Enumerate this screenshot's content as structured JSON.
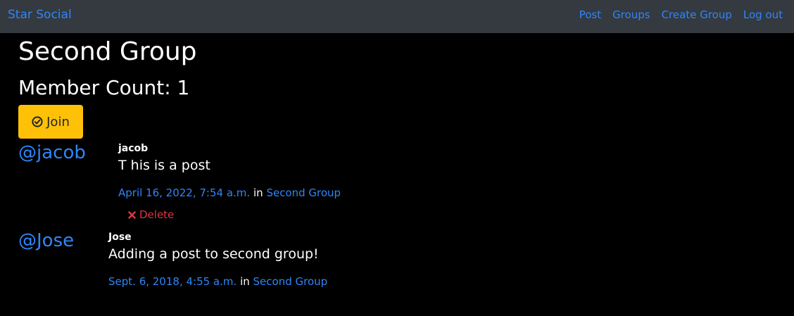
{
  "navbar": {
    "brand": "Star Social",
    "links": [
      "Post",
      "Groups",
      "Create Group",
      "Log out"
    ]
  },
  "group": {
    "title": "Second Group",
    "member_count_label": "Member Count: 1",
    "join_label": "Join"
  },
  "posts": [
    {
      "handle": "@jacob",
      "author": "jacob",
      "message": "T his is a post",
      "date": "April 16, 2022, 7:54 a.m.",
      "in_label": "in",
      "group": "Second Group",
      "delete_label": "Delete"
    },
    {
      "handle": "@Jose",
      "author": "Jose",
      "message": "Adding a post to second group!",
      "date": "Sept. 6, 2018, 4:55 a.m.",
      "in_label": "in",
      "group": "Second Group"
    }
  ],
  "colors": {
    "link": "#2e86f8",
    "navbar": "#343a40",
    "background": "#000000",
    "join_button": "#ffc107",
    "delete": "#dc3545"
  },
  "icons": {
    "join": "check-circle-icon",
    "delete": "close-icon"
  }
}
